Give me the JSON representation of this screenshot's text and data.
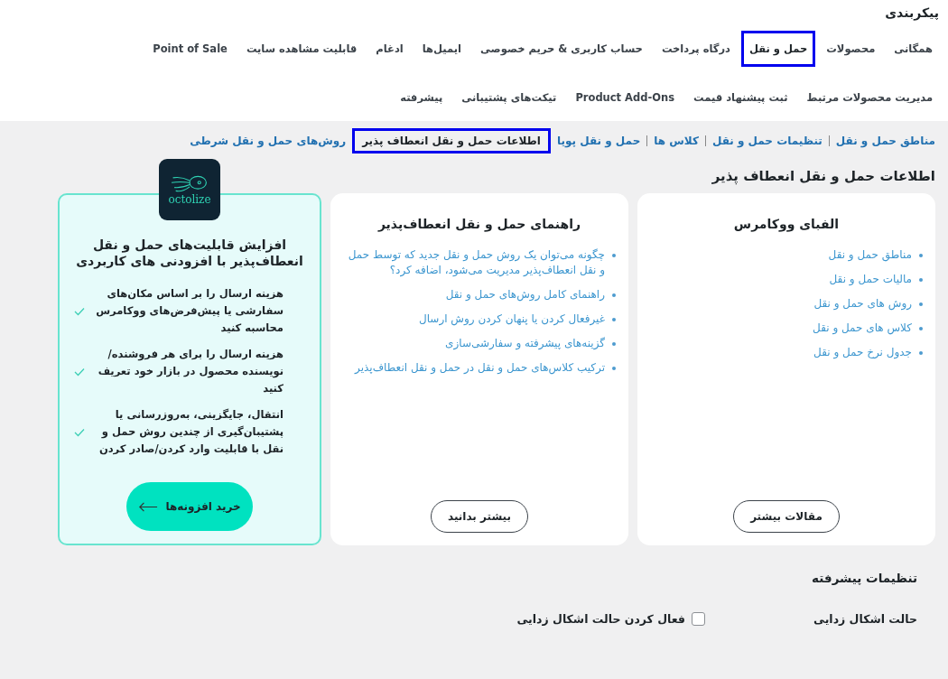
{
  "page_title": "پیکربندی",
  "tabs": [
    {
      "label": "همگانی",
      "selected": false
    },
    {
      "label": "محصولات",
      "selected": false
    },
    {
      "label": "حمل و نقل",
      "selected": true
    },
    {
      "label": "درگاه پرداخت",
      "selected": false
    },
    {
      "label": "حساب کاربری & حریم خصوصی",
      "selected": false
    },
    {
      "label": "ایمیل‌ها",
      "selected": false
    },
    {
      "label": "ادغام",
      "selected": false
    },
    {
      "label": "قابلیت مشاهده سایت",
      "selected": false
    },
    {
      "label": "Point of Sale",
      "selected": false
    },
    {
      "label": "مدیریت محصولات مرتبط",
      "selected": false
    },
    {
      "label": "ثبت پیشنهاد قیمت",
      "selected": false
    },
    {
      "label": "Product Add-Ons",
      "selected": false
    },
    {
      "label": "تیکت‌های پشتیبانی",
      "selected": false
    },
    {
      "label": "پیشرفته",
      "selected": false
    }
  ],
  "subnav": [
    {
      "label": "مناطق حمل و نقل",
      "selected": false
    },
    {
      "label": "تنظیمات حمل و نقل",
      "selected": false
    },
    {
      "label": "کلاس ها",
      "selected": false
    },
    {
      "label": "حمل و نقل پویا",
      "selected": false
    },
    {
      "label": "اطلاعات حمل و نقل انعطاف پذیر",
      "selected": true
    },
    {
      "label": "روش‌های حمل و نقل شرطی",
      "selected": false
    }
  ],
  "section_title": "اطلاعات حمل و نقل انعطاف پذیر",
  "cards": [
    {
      "title": "الفبای ووکامرس",
      "links": [
        "مناطق حمل و نقل",
        "مالیات حمل و نقل",
        "روش های حمل و نقل",
        "کلاس های حمل و نقل",
        "جدول نرخ حمل و نقل"
      ],
      "button": "مقالات بیشتر"
    },
    {
      "title": "راهنمای حمل و نقل انعطاف‌پذیر",
      "links": [
        "چگونه می‌توان یک روش حمل و نقل جدید که توسط حمل و نقل انعطاف‌پذیر مدیریت می‌شود، اضافه کرد؟",
        "راهنمای کامل روش‌های حمل و نقل",
        "غیرفعال کردن یا پنهان کردن روش ارسال",
        "گزینه‌های پیشرفته و سفارشی‌سازی",
        "ترکیب کلاس‌های حمل و نقل در حمل و نقل انعطاف‌پذیر"
      ],
      "button": "بیشتر بدانید"
    }
  ],
  "promo": {
    "logo": "octolize",
    "title": "افزایش قابلیت‌های حمل و نقل انعطاف‌پذیر با افزودنی های کاربردی",
    "features": [
      "هزینه ارسال را بر اساس مکان‌های سفارشی یا پیش‌فرض‌های ووکامرس محاسبه کنید",
      "هزینه ارسال را برای هر فروشنده/ نویسنده محصول در بازار خود تعریف کنید",
      "انتقال، جایگزینی، به‌روزرسانی یا پشتیبان‌گیری از چندین روش حمل و نقل با قابلیت وارد کردن/صادر کردن"
    ],
    "button": "خرید افزونه‌ها"
  },
  "advanced": {
    "title": "تنظیمات پیشرفته",
    "label": "حالت اشکال زدایی",
    "checkbox_label": "فعال کردن حالت اشکال زدایی",
    "checked": false
  }
}
